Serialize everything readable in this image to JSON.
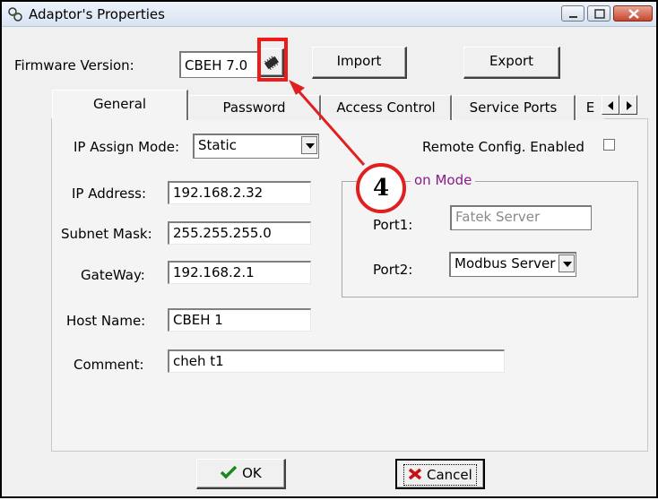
{
  "window": {
    "title": "Adaptor's Properties"
  },
  "firmware": {
    "label": "Firmware Version:",
    "value": "CBEH 7.0",
    "chip_icon": "chip-icon",
    "import_label": "Import",
    "export_label": "Export"
  },
  "tabs": [
    {
      "label": "General",
      "active": true
    },
    {
      "label": "Password",
      "active": false
    },
    {
      "label": "Access Control",
      "active": false
    },
    {
      "label": "Service Ports",
      "active": false
    },
    {
      "label": "E",
      "active": false
    }
  ],
  "general": {
    "ip_assign_label": "IP Assign Mode:",
    "ip_assign_value": "Static",
    "remote_config_label": "Remote Config. Enabled",
    "remote_config_checked": false,
    "ip_address_label": "IP Address:",
    "ip_address_value": "192.168.2.32",
    "subnet_label": "Subnet Mask:",
    "subnet_value": "255.255.255.0",
    "gateway_label": "GateWay:",
    "gateway_value": "192.168.2.1",
    "host_label": "Host Name:",
    "host_value": "CBEH 1",
    "comment_label": "Comment:",
    "comment_value": "cheh t1"
  },
  "operation_mode": {
    "legend": "on Mode",
    "port1_label": "Port1:",
    "port1_value": "Fatek Server",
    "port2_label": "Port2:",
    "port2_value": "Modbus Server"
  },
  "footer": {
    "ok_label": "OK",
    "cancel_label": "Cancel"
  },
  "annotation": {
    "callout_number": "4",
    "color": "#e02020"
  }
}
